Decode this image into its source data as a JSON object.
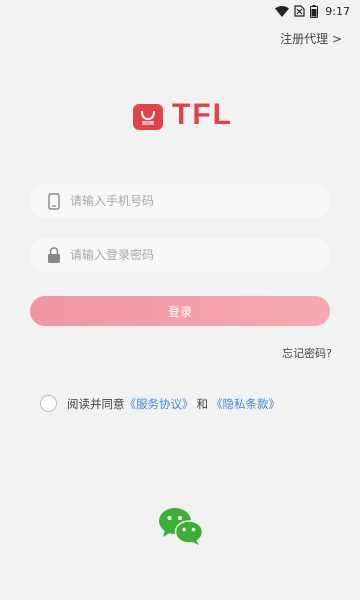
{
  "status_bar": {
    "time": "9:17",
    "icons": [
      "wifi-icon",
      "no-sim-icon",
      "battery-icon"
    ]
  },
  "header": {
    "register_agent_link": "注册代理 >"
  },
  "logo": {
    "text": "TFL",
    "bag_text": "TFL",
    "brand_color": "#e0434a"
  },
  "form": {
    "phone_placeholder": "请输入手机号码",
    "phone_value": "",
    "password_placeholder": "请输入登录密码",
    "password_value": "",
    "login_button": "登录",
    "forgot_password": "忘记密码?"
  },
  "agreement": {
    "prefix": "阅读并同意",
    "service_link": "《服务协议》",
    "conjunction": "和",
    "privacy_link": "《隐私条款》",
    "checked": false
  },
  "social": {
    "icon": "wechat-icon"
  },
  "colors": {
    "background": "#f2f2f2",
    "button_gradient_start": "#ef97a3",
    "button_gradient_end": "#f5a9b0",
    "link": "#3d8ad8",
    "wechat_green": "#3cb034"
  }
}
